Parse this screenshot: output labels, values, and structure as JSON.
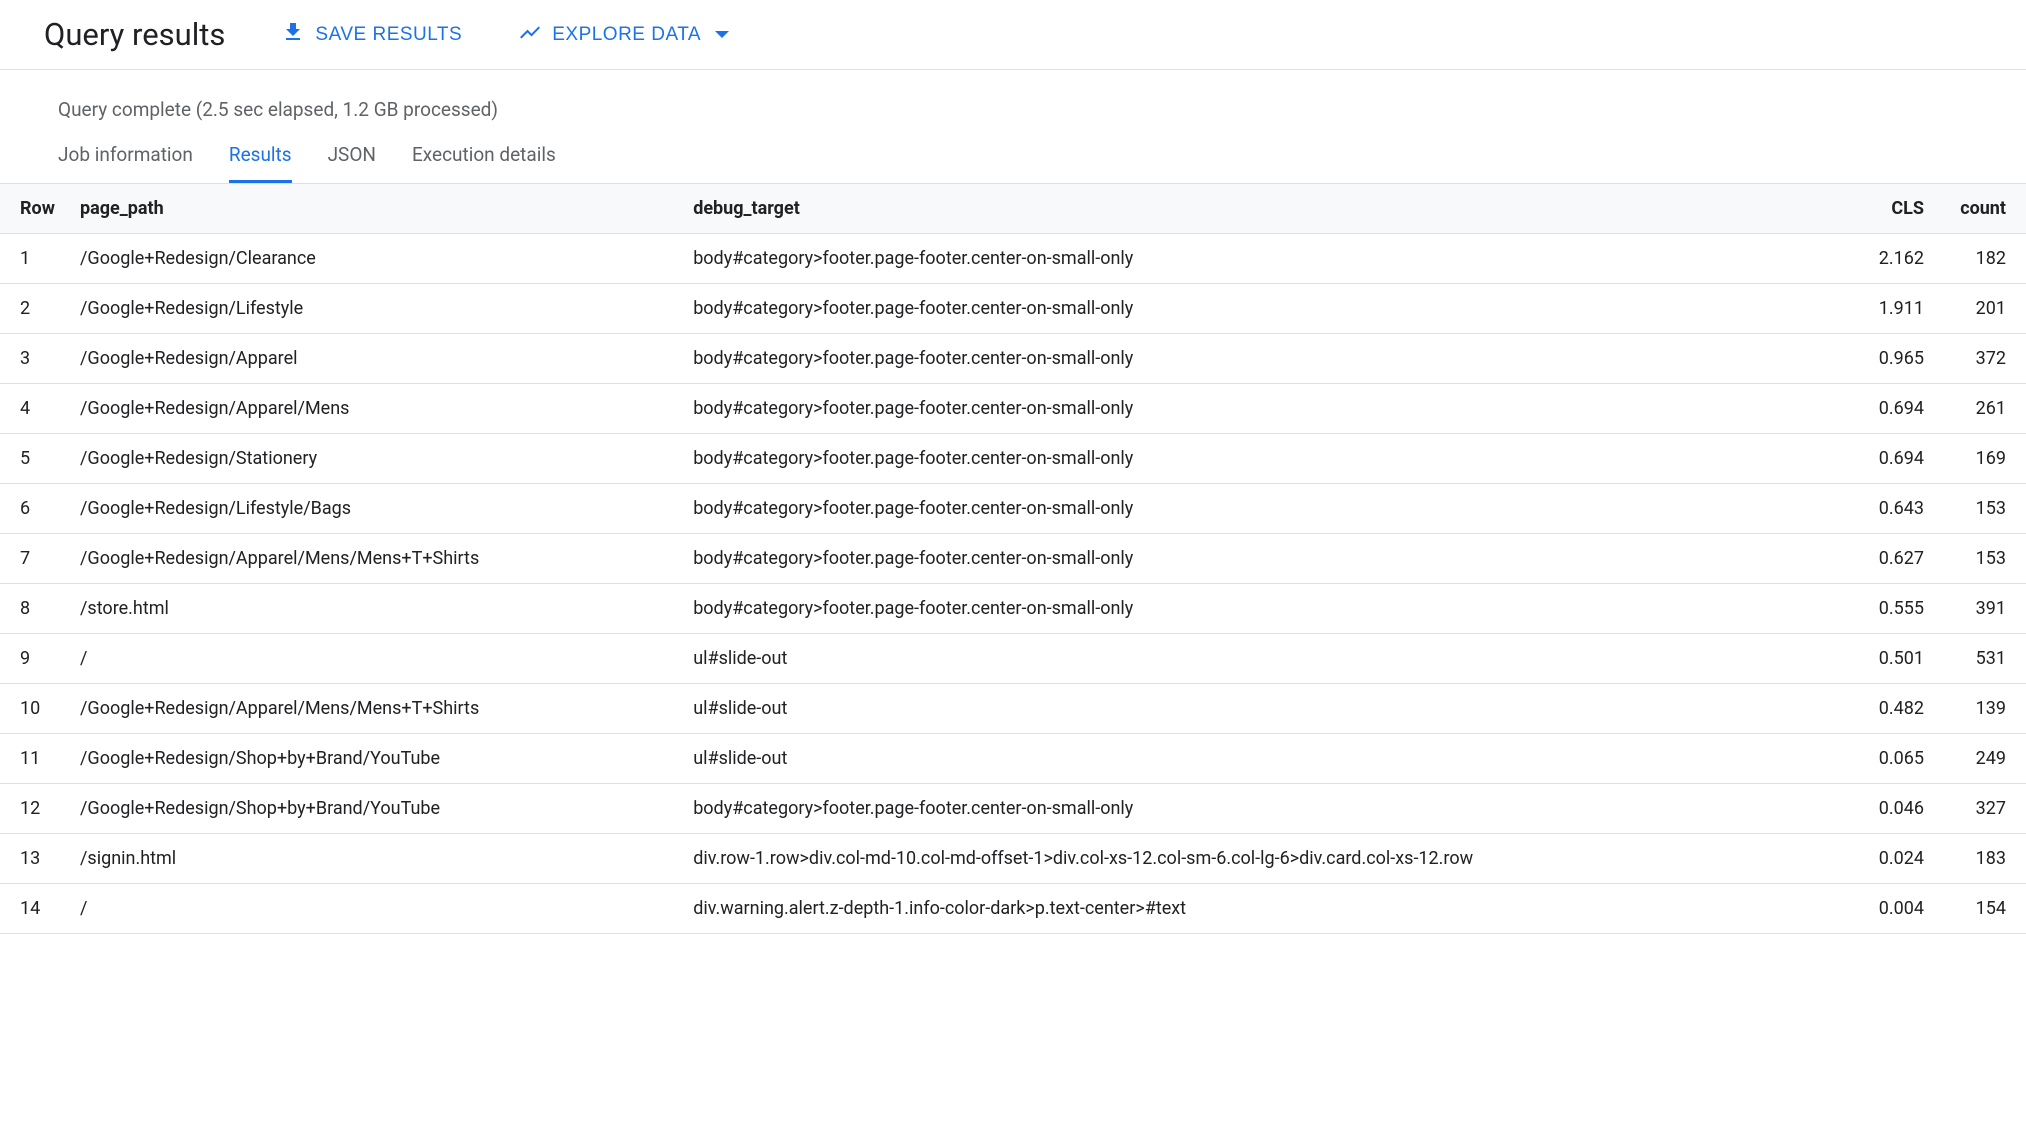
{
  "header": {
    "title": "Query results",
    "save_label": "SAVE RESULTS",
    "explore_label": "EXPLORE DATA"
  },
  "status": "Query complete (2.5 sec elapsed, 1.2 GB processed)",
  "tabs": [
    {
      "label": "Job information",
      "active": false
    },
    {
      "label": "Results",
      "active": true
    },
    {
      "label": "JSON",
      "active": false
    },
    {
      "label": "Execution details",
      "active": false
    }
  ],
  "table": {
    "columns": [
      "Row",
      "page_path",
      "debug_target",
      "CLS",
      "count"
    ],
    "rows": [
      {
        "row": "1",
        "page_path": "/Google+Redesign/Clearance",
        "debug_target": "body#category>footer.page-footer.center-on-small-only",
        "cls": "2.162",
        "count": "182"
      },
      {
        "row": "2",
        "page_path": "/Google+Redesign/Lifestyle",
        "debug_target": "body#category>footer.page-footer.center-on-small-only",
        "cls": "1.911",
        "count": "201"
      },
      {
        "row": "3",
        "page_path": "/Google+Redesign/Apparel",
        "debug_target": "body#category>footer.page-footer.center-on-small-only",
        "cls": "0.965",
        "count": "372"
      },
      {
        "row": "4",
        "page_path": "/Google+Redesign/Apparel/Mens",
        "debug_target": "body#category>footer.page-footer.center-on-small-only",
        "cls": "0.694",
        "count": "261"
      },
      {
        "row": "5",
        "page_path": "/Google+Redesign/Stationery",
        "debug_target": "body#category>footer.page-footer.center-on-small-only",
        "cls": "0.694",
        "count": "169"
      },
      {
        "row": "6",
        "page_path": "/Google+Redesign/Lifestyle/Bags",
        "debug_target": "body#category>footer.page-footer.center-on-small-only",
        "cls": "0.643",
        "count": "153"
      },
      {
        "row": "7",
        "page_path": "/Google+Redesign/Apparel/Mens/Mens+T+Shirts",
        "debug_target": "body#category>footer.page-footer.center-on-small-only",
        "cls": "0.627",
        "count": "153"
      },
      {
        "row": "8",
        "page_path": "/store.html",
        "debug_target": "body#category>footer.page-footer.center-on-small-only",
        "cls": "0.555",
        "count": "391"
      },
      {
        "row": "9",
        "page_path": "/",
        "debug_target": "ul#slide-out",
        "cls": "0.501",
        "count": "531"
      },
      {
        "row": "10",
        "page_path": "/Google+Redesign/Apparel/Mens/Mens+T+Shirts",
        "debug_target": "ul#slide-out",
        "cls": "0.482",
        "count": "139"
      },
      {
        "row": "11",
        "page_path": "/Google+Redesign/Shop+by+Brand/YouTube",
        "debug_target": "ul#slide-out",
        "cls": "0.065",
        "count": "249"
      },
      {
        "row": "12",
        "page_path": "/Google+Redesign/Shop+by+Brand/YouTube",
        "debug_target": "body#category>footer.page-footer.center-on-small-only",
        "cls": "0.046",
        "count": "327"
      },
      {
        "row": "13",
        "page_path": "/signin.html",
        "debug_target": "div.row-1.row>div.col-md-10.col-md-offset-1>div.col-xs-12.col-sm-6.col-lg-6>div.card.col-xs-12.row",
        "cls": "0.024",
        "count": "183"
      },
      {
        "row": "14",
        "page_path": "/",
        "debug_target": "div.warning.alert.z-depth-1.info-color-dark>p.text-center>#text",
        "cls": "0.004",
        "count": "154"
      }
    ]
  }
}
